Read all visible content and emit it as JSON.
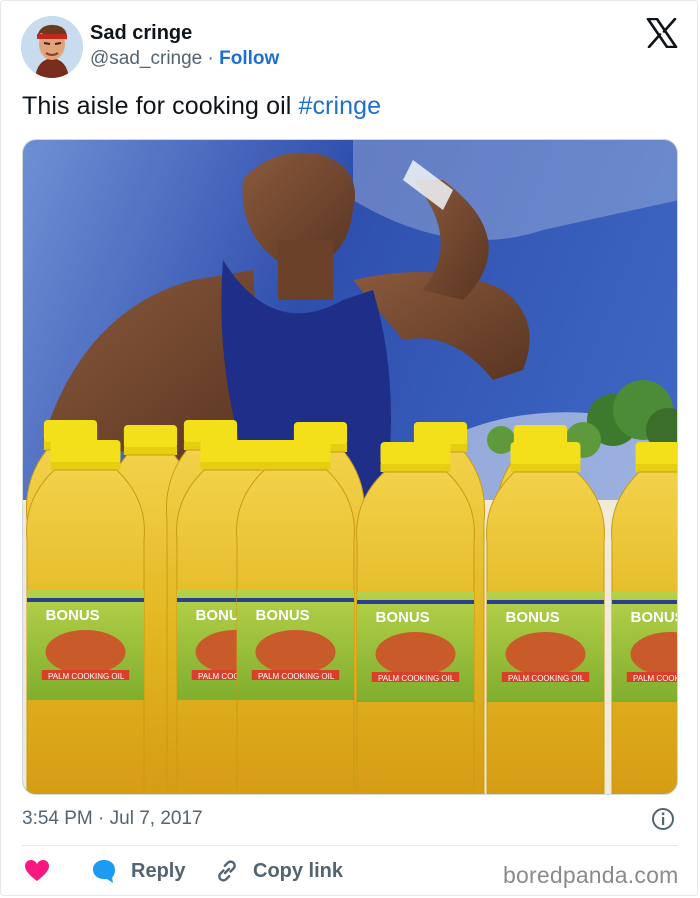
{
  "author": {
    "name": "Sad cringe",
    "handle": "@sad_cringe",
    "separator": "·",
    "follow_label": "Follow"
  },
  "tweet": {
    "text": "This aisle for cooking oil ",
    "hashtag": "#cringe"
  },
  "media": {
    "bottle_brand": "BONUS",
    "bottle_product": "PALM COOKING OIL"
  },
  "meta": {
    "time": "3:54 PM",
    "separator": "·",
    "date": "Jul 7, 2017"
  },
  "actions": {
    "reply_label": "Reply",
    "copy_link_label": "Copy link"
  },
  "credit": "boredpanda.com",
  "colors": {
    "accent": "#1d6fd1",
    "like": "#f91880",
    "reply": "#1d9bf0",
    "muted": "#536471"
  },
  "icons": {
    "close": "x-logo-icon",
    "like": "heart-icon",
    "reply": "speech-bubble-icon",
    "copy": "link-icon",
    "info": "info-icon"
  }
}
